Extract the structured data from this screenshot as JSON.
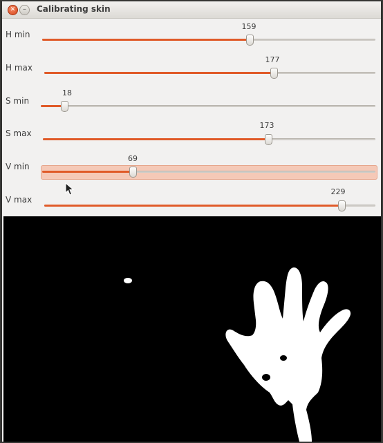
{
  "window": {
    "title": "Calibrating skin"
  },
  "sliders": [
    {
      "label": "H min",
      "value": "159",
      "fraction": 0.623
    },
    {
      "label": "H max",
      "value": "177",
      "fraction": 0.694
    },
    {
      "label": "S min",
      "value": "18",
      "fraction": 0.071
    },
    {
      "label": "S max",
      "value": "173",
      "fraction": 0.678
    },
    {
      "label": "V min",
      "value": "69",
      "fraction": 0.271
    },
    {
      "label": "V max",
      "value": "229",
      "fraction": 0.898
    }
  ],
  "colors": {
    "accent": "#e05a28",
    "hover": "#f5c9b7",
    "mask_bg": "#000000",
    "mask_fg": "#ffffff"
  },
  "icons": {
    "close": "close-icon",
    "minimize": "minimize-icon",
    "cursor": "mouse-pointer-icon"
  }
}
